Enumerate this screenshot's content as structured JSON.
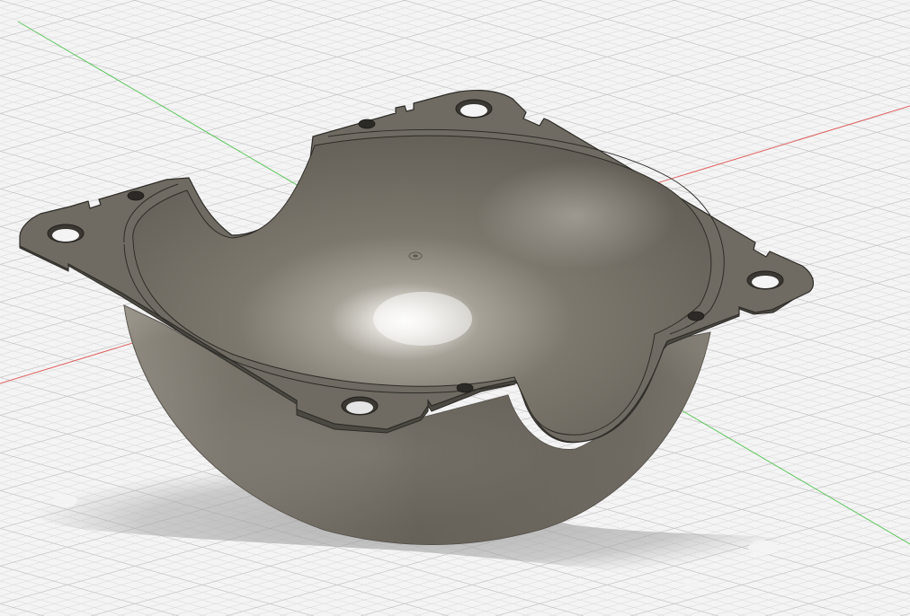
{
  "viewport": {
    "background": "#f4f4f4",
    "grid_minor_color": "#dcdcdc",
    "grid_major_color": "#c4c4c4",
    "x_axis_color": "#e06060",
    "y_axis_color": "#5ec65e",
    "show_grid": true,
    "show_origin_marker": true
  },
  "model": {
    "name": "",
    "type": "hemispherical-shell-with-square-mounting-flange",
    "material_color": "#6f6b62",
    "flange_mounting_holes": 4,
    "flange_small_holes": 4,
    "edge_notches": 8,
    "side_cutouts": 2
  }
}
